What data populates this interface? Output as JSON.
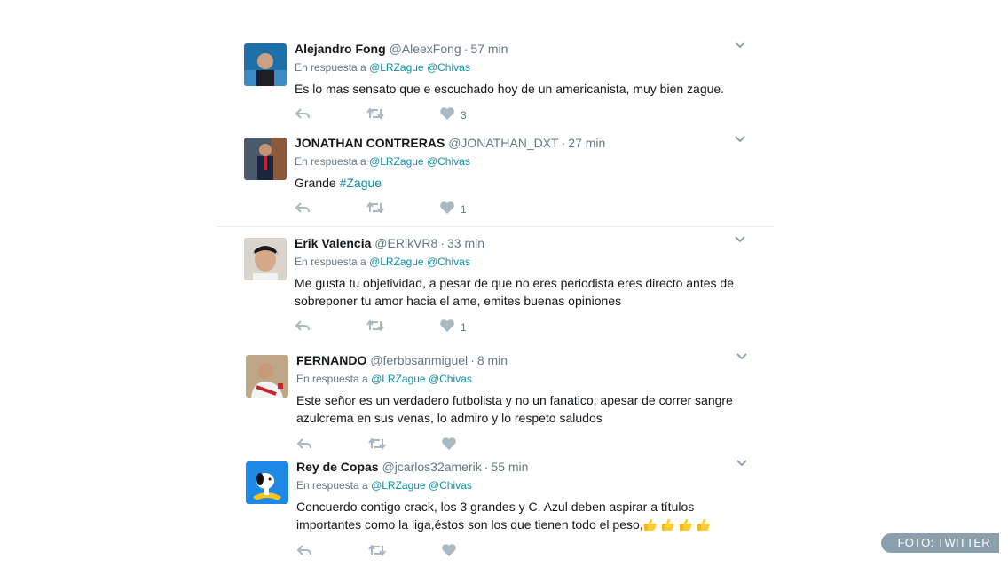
{
  "icons": {
    "reply": "reply-arrow-icon",
    "retweet": "retweet-icon",
    "like": "heart-icon",
    "menu": "chevron-down-icon",
    "emoji": "thumbs-up-emoji"
  },
  "colors": {
    "link": "#0f8ea5",
    "muted": "#657786",
    "action_icon": "#aab8c2"
  },
  "reply_prefix": "En respuesta a",
  "tweets": [
    {
      "name": "Alejandro Fong",
      "handle": "@AleexFong",
      "time": "57 min",
      "mentions": [
        "@LRZague",
        "@Chivas"
      ],
      "text": "Es lo mas sensato que e escuchado hoy de un americanista, muy bien zague.",
      "likes": "3"
    },
    {
      "name": "JONATHAN CONTRERAS",
      "handle": "@JONATHAN_DXT",
      "time": "27 min",
      "mentions": [
        "@LRZague",
        "@Chivas"
      ],
      "text": "Grande ",
      "hashtag": "#Zague",
      "likes": "1"
    },
    {
      "name": "Erik Valencia",
      "handle": "@ERikVR8",
      "time": "33 min",
      "mentions": [
        "@LRZague",
        "@Chivas"
      ],
      "text": "Me gusta tu objetividad, a pesar de que no eres periodista eres directo antes de sobreponer tu amor hacia el ame, emites buenas opiniones",
      "likes": "1"
    },
    {
      "name": "FERNANDO",
      "handle": "@ferbbsanmiguel",
      "time": "8 min",
      "mentions": [
        "@LRZague",
        "@Chivas"
      ],
      "text": "Este señor es un verdadero futbolista y no un fanatico, apesar de correr sangre azulcrema en sus venas, lo admiro y lo respeto saludos",
      "likes": ""
    },
    {
      "name": "Rey de Copas",
      "handle": "@jcarlos32amerik",
      "time": "55 min",
      "mentions": [
        "@LRZague",
        "@Chivas"
      ],
      "text": "Concuerdo contigo crack, los 3 grandes y C. Azul deben aspirar a títulos importantes como la liga,éstos son los que tienen todo el peso,",
      "likes": ""
    }
  ],
  "watermark": "FOTO: TWITTER"
}
